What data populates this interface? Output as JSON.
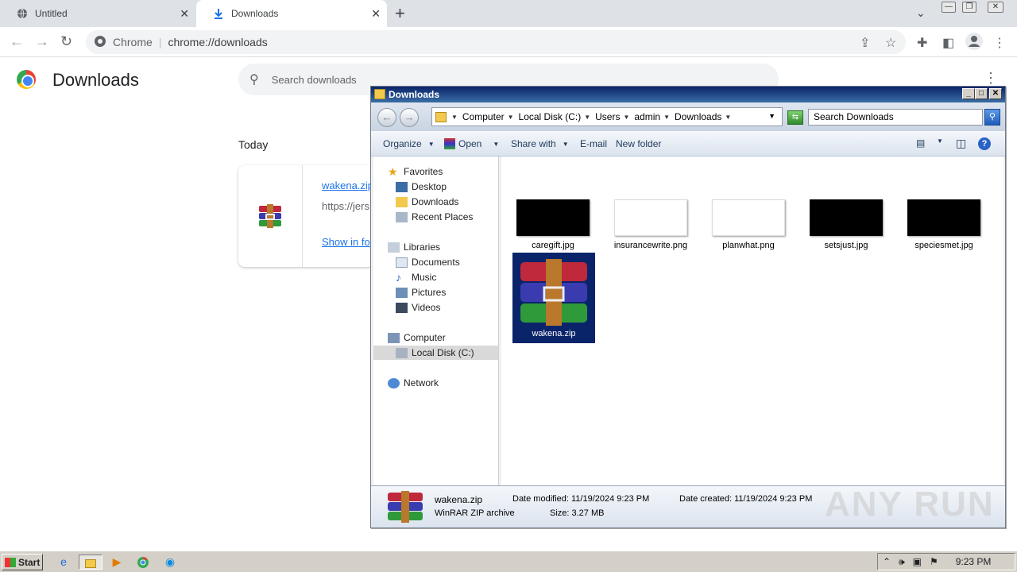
{
  "browser": {
    "tabs": [
      {
        "title": "Untitled",
        "icon": "globe-icon"
      },
      {
        "title": "Downloads",
        "icon": "download-icon",
        "active": true
      }
    ],
    "new_tab_symbol": "+",
    "close_symbol": "✕",
    "omnibox": {
      "site_label": "Chrome",
      "url": "chrome://downloads"
    }
  },
  "downloads_page": {
    "title": "Downloads",
    "search_placeholder": "Search downloads",
    "section": "Today",
    "item": {
      "file_name": "wakena.zip",
      "url": "https://jers",
      "action": "Show in fo"
    }
  },
  "explorer": {
    "title": "Downloads",
    "breadcrumbs": [
      "Computer",
      "Local Disk (C:)",
      "Users",
      "admin",
      "Downloads"
    ],
    "search_placeholder": "Search Downloads",
    "commands": {
      "organize": "Organize",
      "open": "Open",
      "share_with": "Share with",
      "email": "E-mail",
      "new_folder": "New folder"
    },
    "nav": {
      "favorites": "Favorites",
      "desktop": "Desktop",
      "downloads": "Downloads",
      "recent_places": "Recent Places",
      "libraries": "Libraries",
      "documents": "Documents",
      "music": "Music",
      "pictures": "Pictures",
      "videos": "Videos",
      "computer": "Computer",
      "local_disk": "Local Disk (C:)",
      "network": "Network"
    },
    "files": [
      {
        "name": "caregift.jpg",
        "thumb": "black"
      },
      {
        "name": "insurancewrite.png",
        "thumb": "white"
      },
      {
        "name": "planwhat.png",
        "thumb": "white"
      },
      {
        "name": "setsjust.jpg",
        "thumb": "black"
      },
      {
        "name": "speciesmet.jpg",
        "thumb": "black"
      }
    ],
    "selected_file": {
      "name": "wakena.zip"
    },
    "details": {
      "name": "wakena.zip",
      "type": "WinRAR ZIP archive",
      "modified": "Date modified: 11/19/2024 9:23 PM",
      "size": "Size: 3.27 MB",
      "created": "Date created: 11/19/2024 9:23 PM"
    }
  },
  "watermark": "ANY RUN",
  "taskbar": {
    "start": "Start",
    "clock": "9:23 PM"
  },
  "colors": {
    "chrome_link": "#1a73e8",
    "explorer_selection": "#0a246a",
    "taskbar": "#d4d0c8"
  }
}
